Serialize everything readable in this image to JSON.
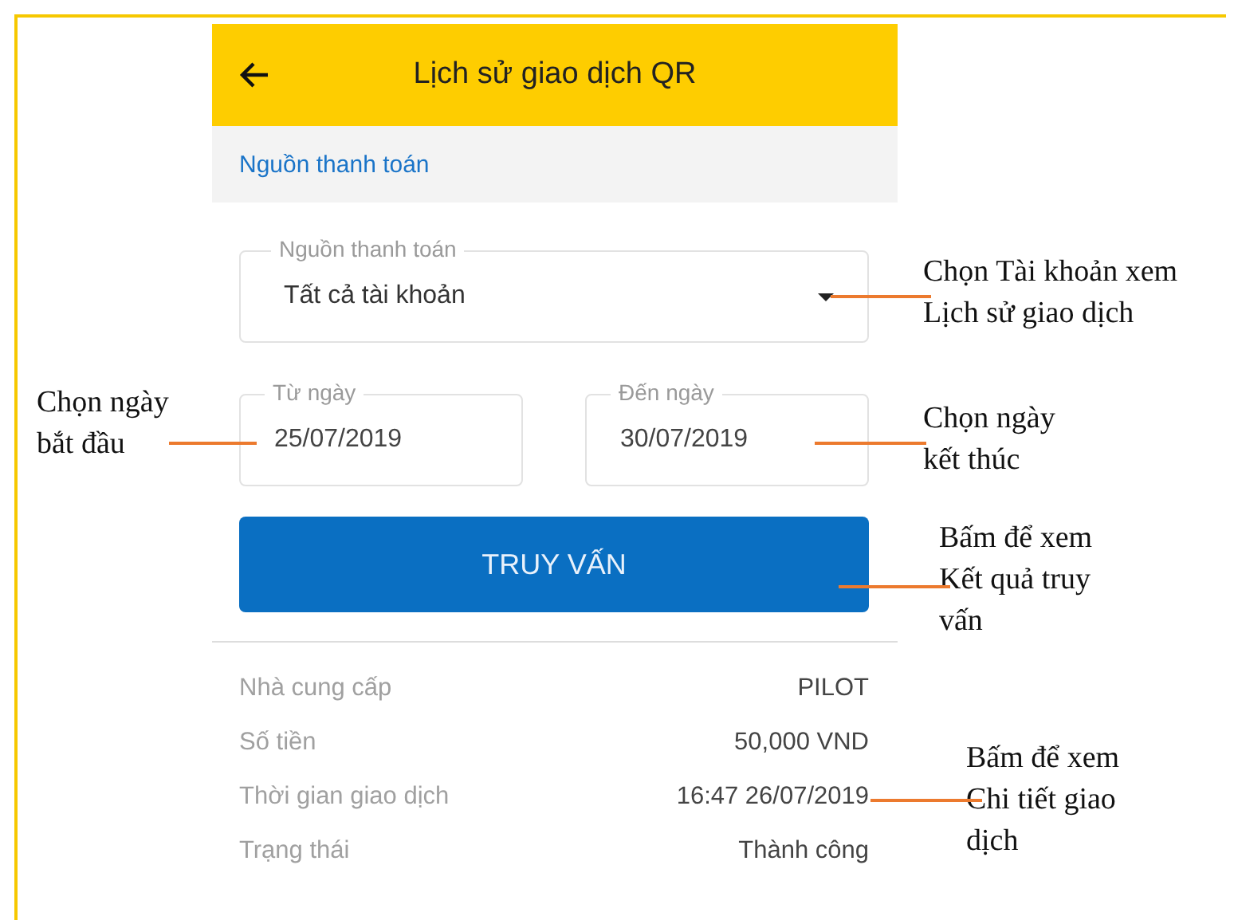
{
  "header": {
    "title": "Lịch sử giao dịch QR"
  },
  "section": {
    "title": "Nguồn thanh toán"
  },
  "source_field": {
    "label": "Nguồn thanh toán",
    "value": "Tất cả tài khoản"
  },
  "date_fields": [
    {
      "label": "Từ ngày",
      "value": "25/07/2019"
    },
    {
      "label": "Đến ngày",
      "value": "30/07/2019"
    }
  ],
  "query_button": {
    "label": "TRUY VẤN"
  },
  "transaction": [
    {
      "label": "Nhà cung cấp",
      "value": "PILOT"
    },
    {
      "label": "Số tiền",
      "value": "50,000 VND"
    },
    {
      "label": "Thời gian giao dịch",
      "value": "16:47 26/07/2019"
    },
    {
      "label": "Trạng thái",
      "value": "Thành công"
    }
  ],
  "annotations": [
    {
      "text": "Chọn Tài khoản xem\nLịch sử giao dịch"
    },
    {
      "text": "Chọn ngày\nbắt đầu"
    },
    {
      "text": "Chọn ngày\nkết thúc"
    },
    {
      "text": "Bấm để xem\nKết quả truy\nvấn"
    },
    {
      "text": "Bấm để xem\nChi tiết giao\ndịch"
    }
  ]
}
